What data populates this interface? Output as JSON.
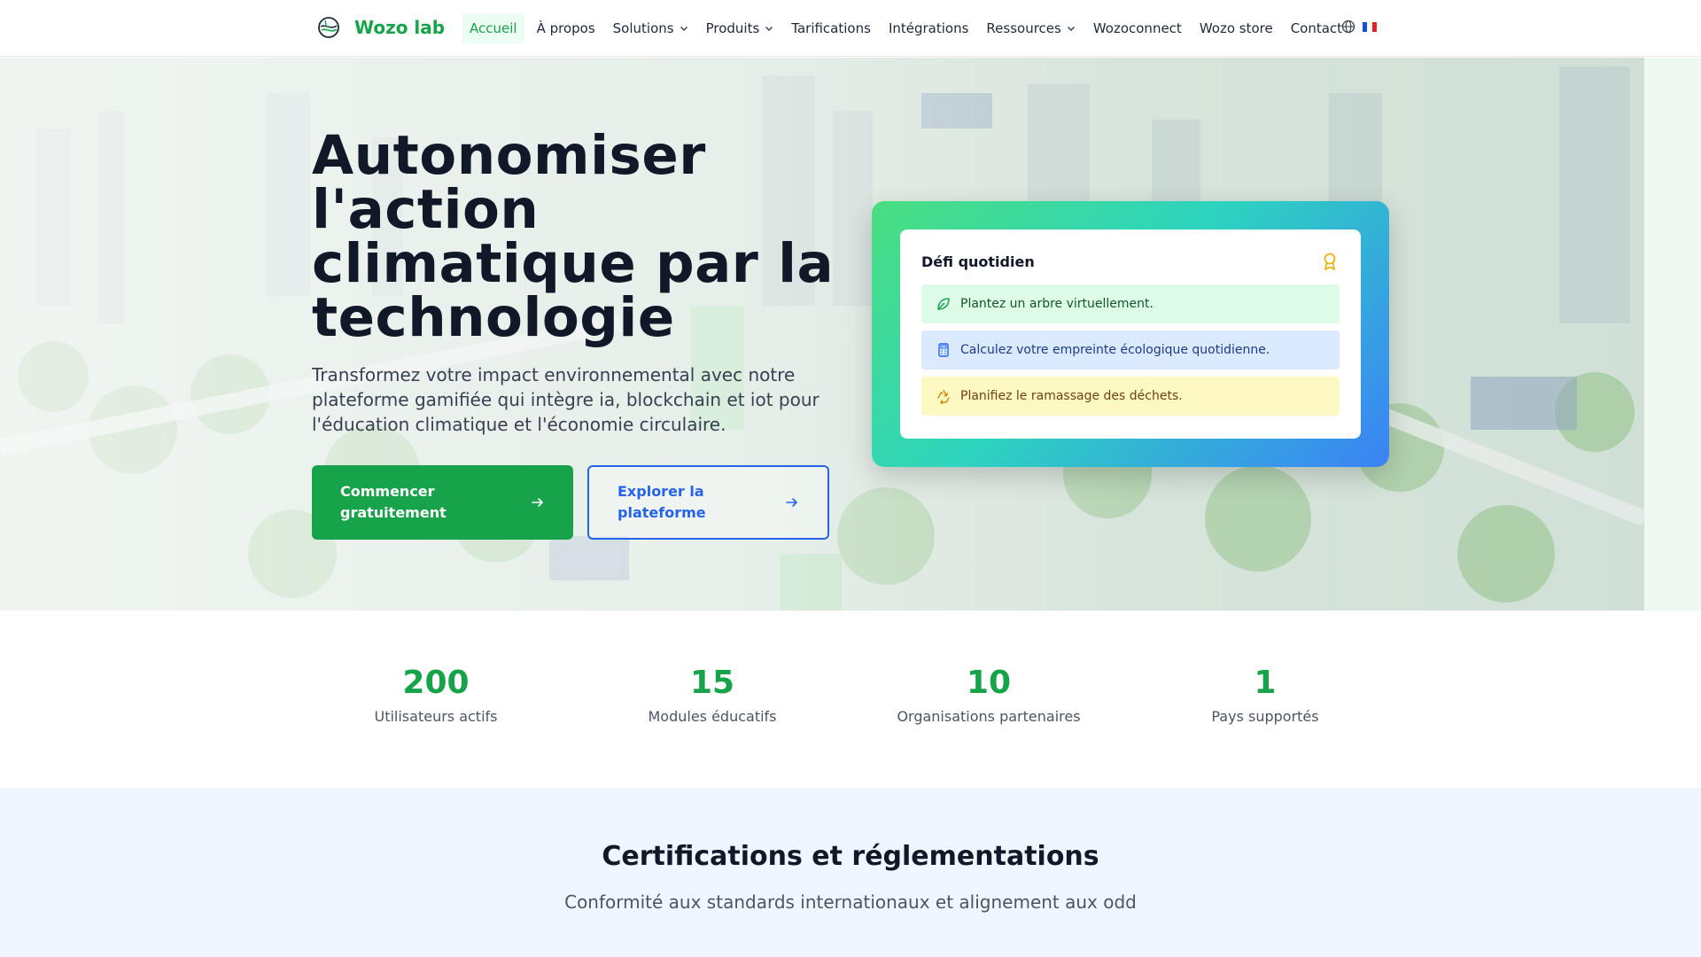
{
  "brand": {
    "name": "Wozo lab",
    "accent": "#16a34a"
  },
  "nav": {
    "items": [
      {
        "label": "Accueil",
        "active": true,
        "dropdown": false
      },
      {
        "label": "À propos",
        "active": false,
        "dropdown": false
      },
      {
        "label": "Solutions",
        "active": false,
        "dropdown": true
      },
      {
        "label": "Produits",
        "active": false,
        "dropdown": true
      },
      {
        "label": "Tarifications",
        "active": false,
        "dropdown": false
      },
      {
        "label": "Intégrations",
        "active": false,
        "dropdown": false
      },
      {
        "label": "Ressources",
        "active": false,
        "dropdown": true
      },
      {
        "label": "Wozoconnect",
        "active": false,
        "dropdown": false
      },
      {
        "label": "Wozo store",
        "active": false,
        "dropdown": false
      },
      {
        "label": "Contact",
        "active": false,
        "dropdown": false
      }
    ],
    "language_icon": "globe-icon",
    "language_flag": "flag-fr-icon"
  },
  "hero": {
    "title": "Autonomiser l'action climatique par la technologie",
    "subtitle": "Transformez votre impact environnemental avec notre plateforme gamifiée qui intègre ia, blockchain et iot pour l'éducation climatique et l'économie circulaire.",
    "primary_cta": "Commencer gratuitement",
    "secondary_cta": "Explorer la plateforme"
  },
  "challenge": {
    "title": "Défi quotidien",
    "icon": "award-icon",
    "tasks": [
      {
        "label": "Plantez un arbre virtuellement.",
        "icon": "leaf-icon",
        "tone": "green"
      },
      {
        "label": "Calculez votre empreinte écologique quotidienne.",
        "icon": "calculator-icon",
        "tone": "blue"
      },
      {
        "label": "Planifiez le ramassage des déchets.",
        "icon": "recycle-icon",
        "tone": "yellow"
      }
    ]
  },
  "stats": [
    {
      "value": "200",
      "label": "Utilisateurs actifs"
    },
    {
      "value": "15",
      "label": "Modules éducatifs"
    },
    {
      "value": "10",
      "label": "Organisations partenaires"
    },
    {
      "value": "1",
      "label": "Pays supportés"
    }
  ],
  "certifications": {
    "title": "Certifications et réglementations",
    "subtitle": "Conformité aux standards internationaux et alignement aux odd"
  },
  "colors": {
    "primary_green": "#16a34a",
    "secondary_blue": "#2563eb",
    "cert_bg": "#eff6ff"
  }
}
